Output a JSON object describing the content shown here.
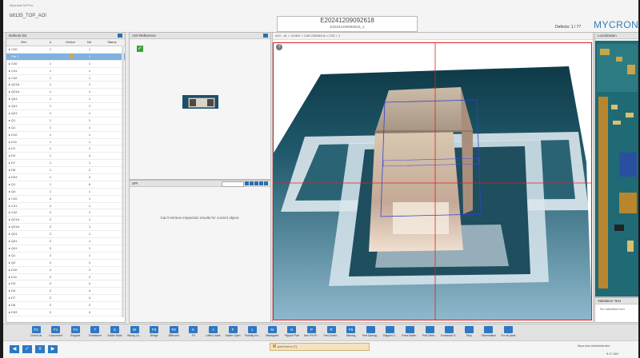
{
  "app": {
    "window_title": "Mycronic MYPro",
    "program_name": "b8135_TOP_AOI",
    "board_id": "E20241209092618",
    "board_sub": "E20241209092618_1",
    "defects_counter": "Defects: 1 / 77",
    "logo": "MYCRONIC"
  },
  "defects_list": {
    "title": "Defects list",
    "columns": [
      "Ref.",
      "#",
      "Defect",
      "Nb.",
      "Status"
    ],
    "rows": [
      {
        "ref": "C20",
        "n": "1",
        "defect": "",
        "nb": "1",
        "status": ""
      },
      {
        "ref": "Pin 1",
        "n": "",
        "defect": "warn",
        "nb": "1",
        "status": "",
        "selected": true
      },
      {
        "ref": "C40",
        "n": "1",
        "defect": "",
        "nb": "1",
        "status": ""
      },
      {
        "ref": "C41",
        "n": "1",
        "defect": "",
        "nb": "1",
        "status": ""
      },
      {
        "ref": "C42",
        "n": "1",
        "defect": "",
        "nb": "1",
        "status": ""
      },
      {
        "ref": "Q21A",
        "n": "1",
        "defect": "",
        "nb": "1",
        "status": ""
      },
      {
        "ref": "Q21A",
        "n": "1",
        "defect": "",
        "nb": "1",
        "status": ""
      },
      {
        "ref": "Q41",
        "n": "1",
        "defect": "",
        "nb": "1",
        "status": ""
      },
      {
        "ref": "Q41",
        "n": "1",
        "defect": "",
        "nb": "1",
        "status": ""
      },
      {
        "ref": "Q41",
        "n": "1",
        "defect": "",
        "nb": "1",
        "status": ""
      },
      {
        "ref": "Q1",
        "n": "1",
        "defect": "",
        "nb": "1",
        "status": ""
      },
      {
        "ref": "Q1",
        "n": "1",
        "defect": "",
        "nb": "1",
        "status": ""
      },
      {
        "ref": "D10",
        "n": "1",
        "defect": "",
        "nb": "1",
        "status": ""
      },
      {
        "ref": "D11",
        "n": "1",
        "defect": "",
        "nb": "1",
        "status": ""
      },
      {
        "ref": "D1",
        "n": "1",
        "defect": "",
        "nb": "1",
        "status": ""
      },
      {
        "ref": "D4",
        "n": "1",
        "defect": "",
        "nb": "4",
        "status": ""
      },
      {
        "ref": "D7",
        "n": "1",
        "defect": "",
        "nb": "1",
        "status": ""
      },
      {
        "ref": "D8",
        "n": "1",
        "defect": "",
        "nb": "2",
        "status": ""
      },
      {
        "ref": "D33",
        "n": "1",
        "defect": "",
        "nb": "2",
        "status": ""
      },
      {
        "ref": "Q1",
        "n": "1",
        "defect": "",
        "nb": "6",
        "status": ""
      },
      {
        "ref": "Q4",
        "n": "1",
        "defect": "",
        "nb": "1",
        "status": ""
      },
      {
        "ref": "C20",
        "n": "2",
        "defect": "",
        "nb": "1",
        "status": ""
      },
      {
        "ref": "C41",
        "n": "2",
        "defect": "",
        "nb": "1",
        "status": ""
      },
      {
        "ref": "C42",
        "n": "2",
        "defect": "",
        "nb": "1",
        "status": ""
      },
      {
        "ref": "Q21A",
        "n": "2",
        "defect": "",
        "nb": "1",
        "status": ""
      },
      {
        "ref": "Q21A",
        "n": "2",
        "defect": "",
        "nb": "1",
        "status": ""
      },
      {
        "ref": "Q21",
        "n": "2",
        "defect": "",
        "nb": "1",
        "status": ""
      },
      {
        "ref": "Q41",
        "n": "2",
        "defect": "",
        "nb": "1",
        "status": ""
      },
      {
        "ref": "Q41",
        "n": "2",
        "defect": "",
        "nb": "1",
        "status": ""
      },
      {
        "ref": "Q1",
        "n": "2",
        "defect": "",
        "nb": "1",
        "status": ""
      },
      {
        "ref": "Q2",
        "n": "2",
        "defect": "",
        "nb": "1",
        "status": ""
      },
      {
        "ref": "D10",
        "n": "2",
        "defect": "",
        "nb": "2",
        "status": ""
      },
      {
        "ref": "D11",
        "n": "2",
        "defect": "",
        "nb": "2",
        "status": ""
      },
      {
        "ref": "D3",
        "n": "2",
        "defect": "",
        "nb": "2",
        "status": ""
      },
      {
        "ref": "D4",
        "n": "2",
        "defect": "",
        "nb": "4",
        "status": ""
      },
      {
        "ref": "D7",
        "n": "2",
        "defect": "",
        "nb": "4",
        "status": ""
      },
      {
        "ref": "D8",
        "n": "2",
        "defect": "",
        "nb": "2",
        "status": ""
      },
      {
        "ref": "D33",
        "n": "2",
        "defect": "",
        "nb": "4",
        "status": ""
      },
      {
        "ref": "Q1",
        "n": "2",
        "defect": "",
        "nb": "4",
        "status": ""
      },
      {
        "ref": "Q4",
        "n": "2",
        "defect": "",
        "nb": "6",
        "status": ""
      },
      {
        "ref": "C20",
        "n": "3",
        "defect": "",
        "nb": "1",
        "status": ""
      },
      {
        "ref": "C40",
        "n": "3",
        "defect": "",
        "nb": "1",
        "status": ""
      },
      {
        "ref": "C41",
        "n": "3",
        "defect": "",
        "nb": "1",
        "status": ""
      },
      {
        "ref": "C42",
        "n": "3",
        "defect": "",
        "nb": "1",
        "status": ""
      }
    ]
  },
  "aoi_reference": {
    "title": "AOI Reference",
    "status_icon": "check-icon"
  },
  "spi": {
    "title": "SPI",
    "message": "Can't retrieve inspection results for current object."
  },
  "view3d": {
    "breadcrumb": "AOI - #1 > C0402 > CAP-000045-A > C20 > 1"
  },
  "localization": {
    "title": "Localization"
  },
  "validation": {
    "title": "Validation Text",
    "message": "No validation text"
  },
  "toolbar": {
    "buttons": [
      {
        "key": "F2",
        "label": "Check ok"
      },
      {
        "key": "F1",
        "label": "Uncovered"
      },
      {
        "key": "F3",
        "label": "Skipped"
      },
      {
        "key": "T",
        "label": "Tombstone"
      },
      {
        "key": "S",
        "label": "Solder Balls"
      },
      {
        "key": "W",
        "label": "Wrong Co..."
      },
      {
        "key": "F6",
        "label": "Bridge"
      },
      {
        "key": "F8",
        "label": "Billboard"
      },
      {
        "key": "K",
        "label": "Fit"
      },
      {
        "key": "J",
        "label": "Lifted Leads"
      },
      {
        "key": "F",
        "label": "Solder Open"
      },
      {
        "key": "L",
        "label": "Polarity Inv..."
      },
      {
        "key": "M",
        "label": "Misaligned"
      },
      {
        "key": "N",
        "label": "Flipped Part"
      },
      {
        "key": "P",
        "label": "Non Pol Pi..."
      },
      {
        "key": "R",
        "label": "Part Under..."
      },
      {
        "key": "F5",
        "label": "Missing"
      },
      {
        "key": "",
        "label": "Part Damag..."
      },
      {
        "key": "",
        "label": "Shipped C..."
      },
      {
        "key": "",
        "label": "Extra Matte..."
      },
      {
        "key": "",
        "label": "Part Defor..."
      },
      {
        "key": "",
        "label": "Excessive S..."
      },
      {
        "key": "",
        "label": "Stop"
      },
      {
        "key": "",
        "label": "Observation"
      },
      {
        "key": "",
        "label": "For all parts"
      }
    ]
  },
  "status": {
    "point_error": "point error (7)",
    "user": "Mycronic Administrator",
    "clock": "9:17 AM"
  },
  "colors": {
    "accent": "#2d78c4",
    "selected_row": "#7fb2e0",
    "crosshair": "#e02020",
    "ok": "#3aa43a"
  }
}
